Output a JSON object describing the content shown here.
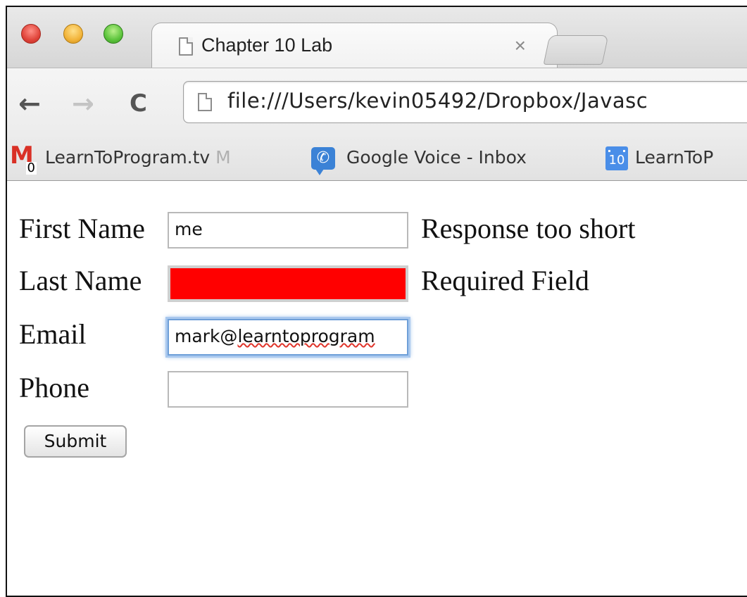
{
  "browser": {
    "tab": {
      "title": "Chapter 10 Lab",
      "close_glyph": "×"
    },
    "toolbar": {
      "back_glyph": "←",
      "forward_glyph": "→",
      "reload_glyph": "C",
      "url": "file:///Users/kevin05492/Dropbox/Javasc"
    },
    "bookmarks": [
      {
        "label": "LearnToProgram.tv",
        "faded_suffix": " M",
        "icon": "gmail-icon",
        "badge": "0"
      },
      {
        "label": "Google Voice - Inbox",
        "icon": "google-voice-icon"
      },
      {
        "label": "LearnToP",
        "icon": "calendar-icon",
        "badge": "10"
      }
    ]
  },
  "form": {
    "first_name": {
      "label": "First Name",
      "value": "me",
      "message": "Response too short"
    },
    "last_name": {
      "label": "Last Name",
      "value": "",
      "message": "Required Field",
      "error_color": "#ff0000"
    },
    "email": {
      "label": "Email",
      "value_prefix": "mark@",
      "value_misspelled": "learntoprogram"
    },
    "phone": {
      "label": "Phone",
      "value": ""
    },
    "submit_label": "Submit"
  }
}
